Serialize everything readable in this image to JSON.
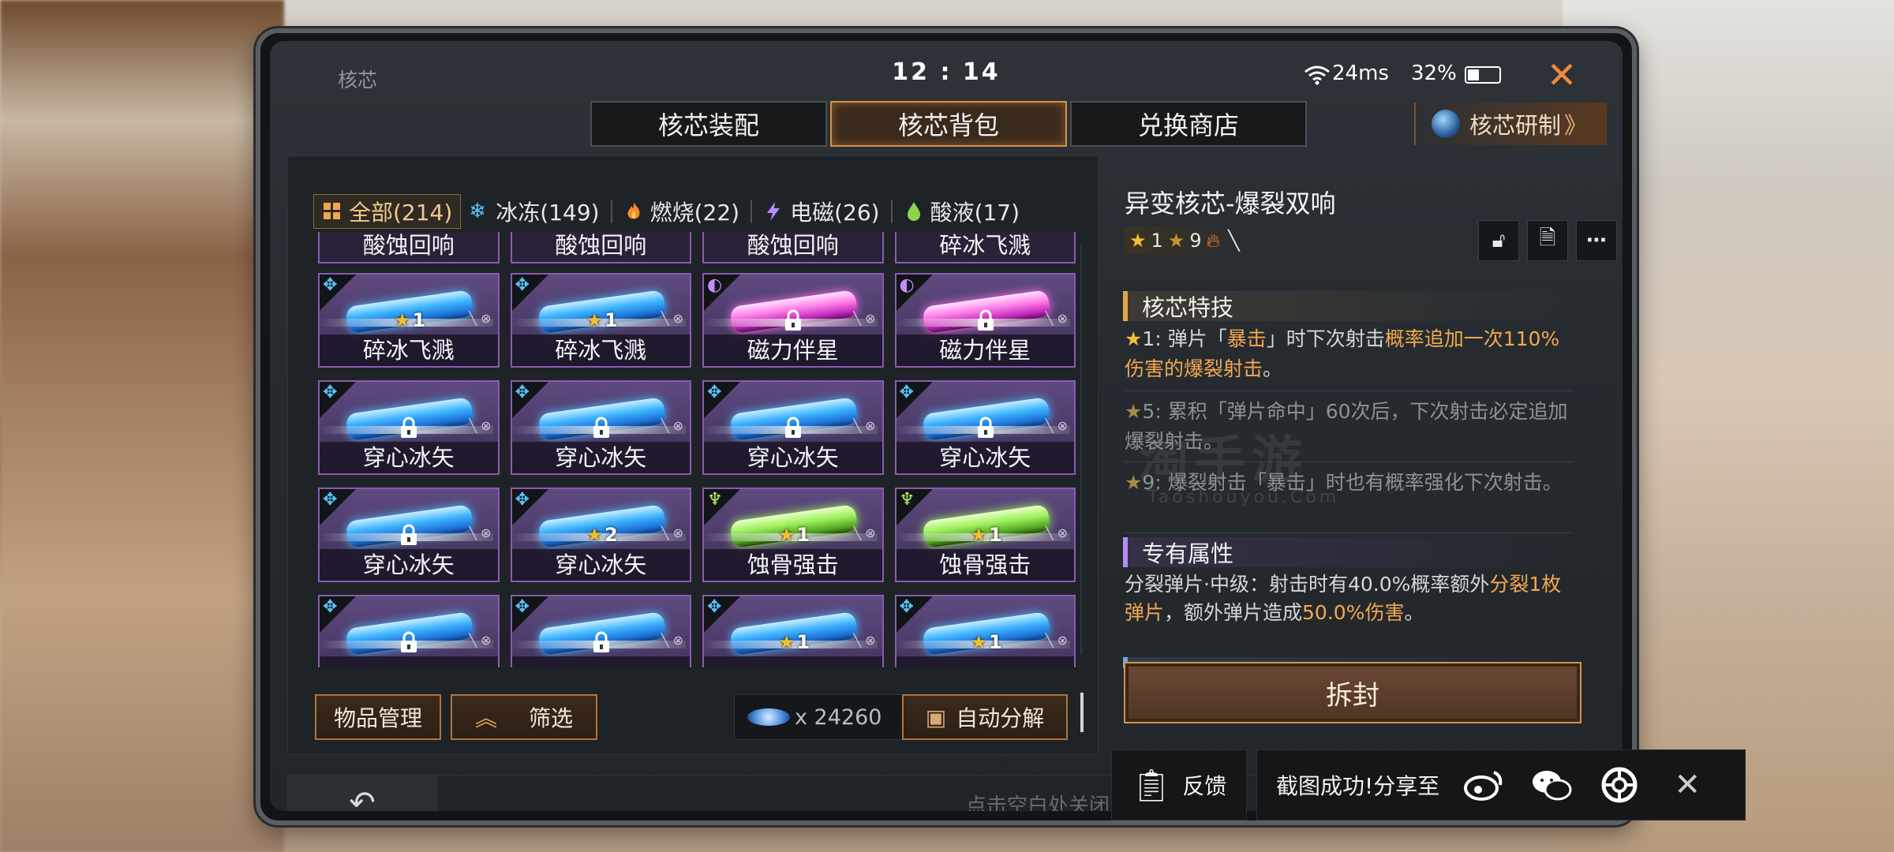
{
  "status": {
    "app_title": "核芯",
    "time": "12 : 14",
    "ping": "24ms",
    "battery": "32%"
  },
  "tabs": [
    {
      "label": "核芯装配",
      "active": false
    },
    {
      "label": "核芯背包",
      "active": true
    },
    {
      "label": "兑换商店",
      "active": false
    }
  ],
  "research_label": "核芯研制",
  "filters": [
    {
      "label": "全部(214)",
      "icon": "grid-icon",
      "active": true
    },
    {
      "label": "冰冻(149)",
      "icon": "snowflake-icon"
    },
    {
      "label": "燃烧(22)",
      "icon": "flame-icon"
    },
    {
      "label": "电磁(26)",
      "icon": "lightning-icon"
    },
    {
      "label": "酸液(17)",
      "icon": "acid-drop-icon"
    }
  ],
  "grid": {
    "row0": [
      "酸蚀回响",
      "酸蚀回响",
      "酸蚀回响",
      "碎冰飞溅"
    ],
    "rows": [
      [
        {
          "name": "碎冰飞溅",
          "color": "blue",
          "icon": "ice-icon",
          "stars": "1",
          "locked": false
        },
        {
          "name": "碎冰飞溅",
          "color": "blue",
          "icon": "ice-icon",
          "stars": "1",
          "locked": false
        },
        {
          "name": "磁力伴星",
          "color": "pink",
          "icon": "magnet-icon",
          "stars": "",
          "locked": true
        },
        {
          "name": "磁力伴星",
          "color": "pink",
          "icon": "magnet-icon",
          "stars": "",
          "locked": true
        }
      ],
      [
        {
          "name": "穿心冰矢",
          "color": "blue",
          "icon": "ice-icon",
          "stars": "",
          "locked": true
        },
        {
          "name": "穿心冰矢",
          "color": "blue",
          "icon": "ice-icon",
          "stars": "",
          "locked": true
        },
        {
          "name": "穿心冰矢",
          "color": "blue",
          "icon": "ice-icon",
          "stars": "",
          "locked": true
        },
        {
          "name": "穿心冰矢",
          "color": "blue",
          "icon": "ice-icon",
          "stars": "",
          "locked": true
        }
      ],
      [
        {
          "name": "穿心冰矢",
          "color": "blue",
          "icon": "ice-icon",
          "stars": "",
          "locked": true
        },
        {
          "name": "穿心冰矢",
          "color": "blue",
          "icon": "ice-icon",
          "stars": "2",
          "locked": false
        },
        {
          "name": "蚀骨强击",
          "color": "green",
          "icon": "acid-icon",
          "stars": "1",
          "locked": false
        },
        {
          "name": "蚀骨强击",
          "color": "green",
          "icon": "acid-icon",
          "stars": "1",
          "locked": false
        }
      ],
      [
        {
          "name": "",
          "color": "blue",
          "icon": "ice-icon",
          "stars": "",
          "locked": true
        },
        {
          "name": "",
          "color": "blue",
          "icon": "ice-icon",
          "stars": "",
          "locked": true
        },
        {
          "name": "",
          "color": "blue",
          "icon": "ice-icon",
          "stars": "1",
          "locked": false
        },
        {
          "name": "",
          "color": "blue",
          "icon": "ice-icon",
          "stars": "1",
          "locked": false
        }
      ]
    ]
  },
  "buttons": {
    "manage": "物品管理",
    "filter": "筛选",
    "auto_decompose": "自动分解",
    "unseal": "拆封"
  },
  "crystal_count": "x 24260",
  "detail": {
    "title": "异变核芯-爆裂双响",
    "meta_star": "1",
    "meta_rank": "9",
    "skill_section": "核芯特技",
    "skills": [
      {
        "prefix": "1: 弹片「",
        "hl1": "暴击",
        "mid": "」时下次射击",
        "hl2": "概率追加一次110%伤害的爆裂射击",
        "suffix": "。",
        "dim": false
      },
      {
        "prefix": "5: 累积「弹片命中」60次后，下次射击必定追加爆裂射击。",
        "dim": true
      },
      {
        "prefix": "9: 爆裂射击「暴击」时也有概率强化下次射击。",
        "dim": true
      }
    ],
    "attr_section": "专有属性",
    "attr_a": "分裂弹片·中级：射击时有40.0%概率额外",
    "attr_hl1": "分裂1枚弹片",
    "attr_b": "，额外弹片造成",
    "attr_hl2": "50.0%伤害",
    "attr_c": "。"
  },
  "bottom": {
    "hint": "点击空白处关闭",
    "feedback": "反馈",
    "share_text": "截图成功!分享至"
  },
  "watermark": {
    "main": "淘手游",
    "sub": "Taoshouyou.Com"
  }
}
